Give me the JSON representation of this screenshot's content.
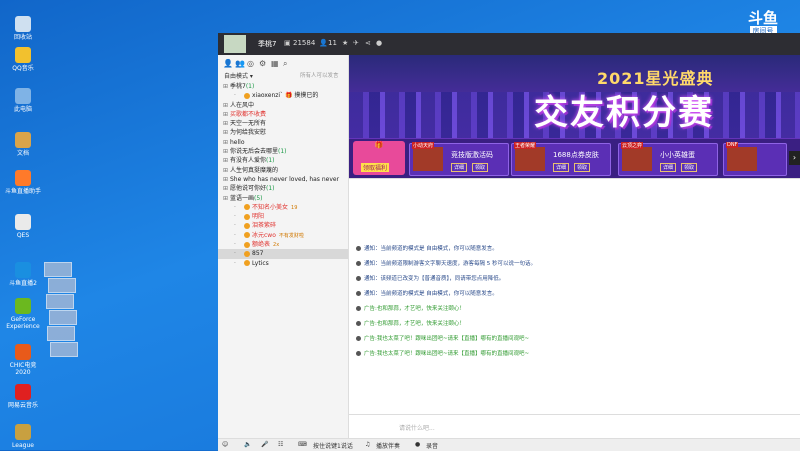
{
  "desktop": {
    "icons": [
      {
        "label": "回收站",
        "color": "#cfe0f0"
      },
      {
        "label": "QQ音乐",
        "color": "#f2c12e"
      },
      {
        "label": "此电脑",
        "color": "#7fb3e6"
      },
      {
        "label": "文档",
        "color": "#d9a44a"
      },
      {
        "label": "斗鱼直播助手",
        "color": "#ff7a2a"
      },
      {
        "label": "QES",
        "color": "#eaeaea"
      },
      {
        "label": "斗鱼直播2",
        "color": "#1a8fe0"
      },
      {
        "label": "GeForce Experience",
        "color": "#6bb81f"
      },
      {
        "label": "CHIC电竞 2020",
        "color": "#e85a1a"
      },
      {
        "label": "网易云音乐",
        "color": "#e02020"
      },
      {
        "label": "League",
        "color": "#c8a040"
      }
    ]
  },
  "app": {
    "streamer_name": "季桃7",
    "follower_count": "21584",
    "viewer_count": "11",
    "logo": "斗鱼",
    "room_label": "房间号",
    "room_id": "9935628"
  },
  "left_panel": {
    "mode": "自由模式",
    "mode_hint": "所有人可以发言",
    "rows": [
      {
        "text": "季桃7",
        "count": "(1)",
        "type": "group"
      },
      {
        "text": "xiaoxenzi` 🎁 摸摸已的",
        "type": "sub"
      },
      {
        "text": "人在风中",
        "type": "group"
      },
      {
        "text": "买歌都不收费",
        "type": "group",
        "red": true
      },
      {
        "text": "天空一无所有",
        "type": "group"
      },
      {
        "text": "为何给我安慰",
        "type": "group"
      },
      {
        "text": "hello",
        "type": "group"
      },
      {
        "text": "你说无后会去哪里",
        "count": "(1)",
        "type": "group"
      },
      {
        "text": "有没有人爱你",
        "count": "(1)",
        "type": "group"
      },
      {
        "text": "人生何真挺糜蔑的",
        "type": "group"
      },
      {
        "text": "She who has never loved, has never",
        "type": "group"
      },
      {
        "text": "愿他说可你好",
        "count": "(1)",
        "type": "group"
      },
      {
        "text": "蓝语一画",
        "count": "(5)",
        "type": "group"
      },
      {
        "text": "不知名小美女",
        "extra": "19",
        "type": "sub",
        "red": true
      },
      {
        "text": "明阳",
        "type": "sub",
        "red": true
      },
      {
        "text": "泪茶紫碎",
        "type": "sub",
        "red": true
      },
      {
        "text": "冰元cwo",
        "extra": "不有发财啦",
        "type": "sub",
        "red": true
      },
      {
        "text": "额绝表",
        "extra": "2x",
        "type": "sub",
        "red": true
      },
      {
        "text": "857",
        "type": "sub",
        "selected": true
      },
      {
        "text": "Lytics",
        "type": "sub"
      }
    ]
  },
  "banner": {
    "subtitle": "2021星光盛典",
    "title": "交友积分赛",
    "gift_label": "领取福利",
    "tickets": [
      {
        "tag": "小动天府",
        "title": "竞技版激活码",
        "btn1": "详细",
        "btn2": "领取"
      },
      {
        "tag": "王者荣耀",
        "title": "1688点券皮肤",
        "btn1": "详细",
        "btn2": "领取"
      },
      {
        "tag": "云顶之弈",
        "title": "小小英雄蛋",
        "btn1": "详细",
        "btn2": "领取"
      },
      {
        "tag": "DNF",
        "title": "",
        "btn1": "",
        "btn2": ""
      }
    ],
    "arrow": "›"
  },
  "chat": {
    "messages": [
      {
        "text": "通知：当前频道的模式是 自由模式，你可以随意发言。",
        "type": "sys"
      },
      {
        "text": "通知：当前频道限制游客文字聊天速度，游客每隔 5 秒可以说一句话。",
        "type": "sys"
      },
      {
        "text": "通知：该频道已改变为【普通音质】，同请带您点用降低。",
        "type": "sys"
      },
      {
        "text": "通知：当前频道的模式是 自由模式，你可以随意发言。",
        "type": "sys"
      },
      {
        "text": "广告:也和那蒜，才艺吧，快来关注颐心！",
        "type": "ad"
      },
      {
        "text": "广告:也和那蒜，才艺吧，快来关注颐心！",
        "type": "ad"
      },
      {
        "text": "广告:我也太菜了吧！跟咪出团吧~请来【直播】哪有的直播间观吧~",
        "type": "ad"
      },
      {
        "text": "广告:我也太菜了吧！跟咪出团吧~请来【直播】哪有的直播间观吧~",
        "type": "ad"
      }
    ],
    "input_placeholder": "请说什么吧..."
  },
  "bottom": {
    "mic_label": "按住说键1说话",
    "music_label": "播放伴奏",
    "record_label": "录音"
  }
}
